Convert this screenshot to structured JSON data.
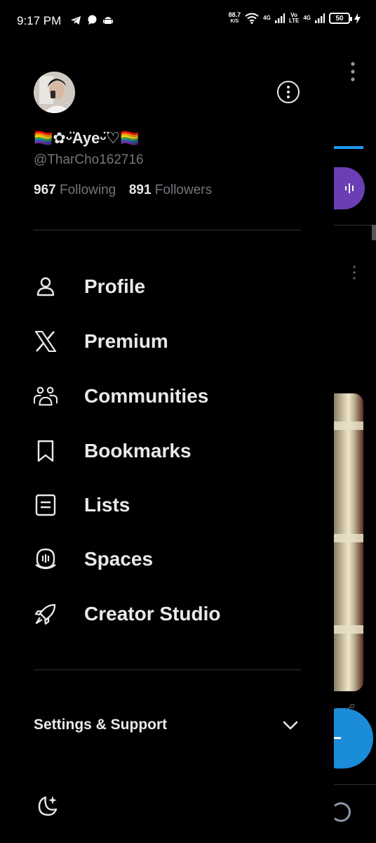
{
  "status_bar": {
    "time": "9:17 PM",
    "speed_value": "88.7",
    "speed_unit": "K/S",
    "net1": "4G",
    "volte_top": "Vo",
    "volte_bottom": "LTE",
    "net2": "4G",
    "battery": "50"
  },
  "profile": {
    "display_name": "🏳️‍🌈✿ᵕ̈Ayeᵕ̈♡🏳️‍🌈",
    "handle": "@TharCho162716",
    "following_count": "967",
    "following_label": "Following",
    "followers_count": "891",
    "followers_label": "Followers"
  },
  "menu": [
    {
      "label": "Profile",
      "icon": "person-icon"
    },
    {
      "label": "Premium",
      "icon": "x-logo-icon"
    },
    {
      "label": "Communities",
      "icon": "communities-icon"
    },
    {
      "label": "Bookmarks",
      "icon": "bookmark-icon"
    },
    {
      "label": "Lists",
      "icon": "list-icon"
    },
    {
      "label": "Spaces",
      "icon": "spaces-icon"
    },
    {
      "label": "Creator Studio",
      "icon": "rocket-icon"
    }
  ],
  "settings": {
    "label": "Settings & Support"
  },
  "colors": {
    "background": "#000000",
    "text": "#e7e9ea",
    "secondary": "#71767b",
    "divider": "#2f3336",
    "accent": "#1d9bf0",
    "spaces_purple": "#6a3fb5"
  }
}
